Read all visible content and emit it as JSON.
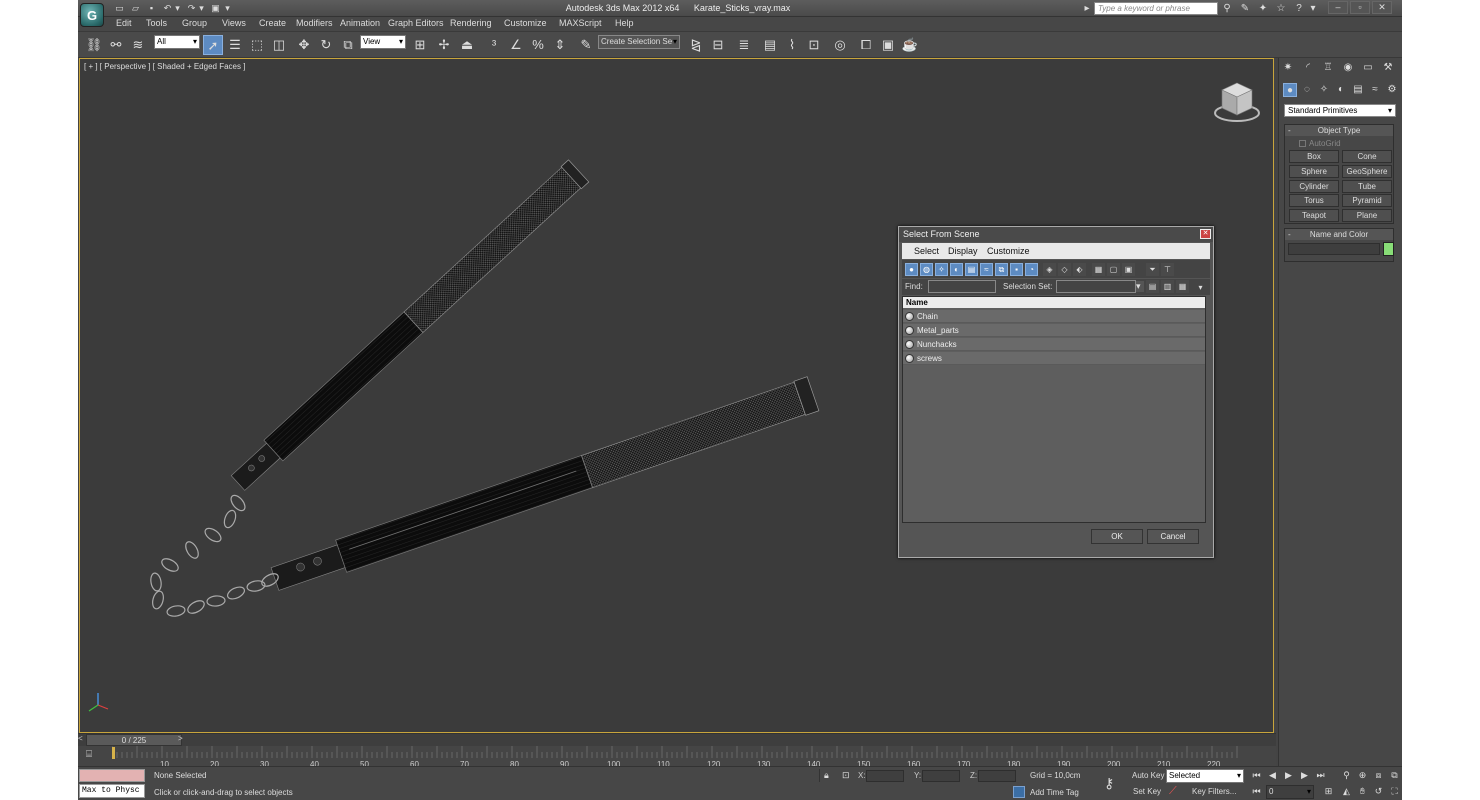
{
  "app": {
    "name": "Autodesk 3ds Max  2012 x64",
    "file": "Karate_Sticks_vray.max",
    "logo_letter": "G"
  },
  "search": {
    "placeholder": "Type a keyword or phrase"
  },
  "menu": [
    "Edit",
    "Tools",
    "Group",
    "Views",
    "Create",
    "Modifiers",
    "Animation",
    "Graph Editors",
    "Rendering",
    "Customize",
    "MAXScript",
    "Help"
  ],
  "toolbar": {
    "selection_filter": "All",
    "ref_coord": "View",
    "named_selection": "Create Selection Se"
  },
  "viewport": {
    "label": "[ + ] [ Perspective ] [ Shaded + Edged Faces ]",
    "active_color": "#c8a53c"
  },
  "command_panel": {
    "category": "Standard Primitives",
    "object_type_title": "Object Type",
    "autogrid_label": "AutoGrid",
    "buttons": [
      "Box",
      "Cone",
      "Sphere",
      "GeoSphere",
      "Cylinder",
      "Tube",
      "Torus",
      "Pyramid",
      "Teapot",
      "Plane"
    ],
    "name_color_title": "Name and Color",
    "object_color": "#88dd77"
  },
  "dialog": {
    "title": "Select From Scene",
    "menu": [
      "Select",
      "Display",
      "Customize"
    ],
    "find_label": "Find:",
    "selection_set_label": "Selection Set:",
    "column_name": "Name",
    "rows": [
      "Chain",
      "Metal_parts",
      "Nunchacks",
      "screws"
    ],
    "ok": "OK",
    "cancel": "Cancel"
  },
  "timeline": {
    "frame_label": "0 / 225",
    "ticks": [
      "10",
      "20",
      "30",
      "40",
      "50",
      "60",
      "70",
      "80",
      "90",
      "100",
      "110",
      "120",
      "130",
      "140",
      "150",
      "160",
      "170",
      "180",
      "190",
      "200",
      "210",
      "220"
    ]
  },
  "status": {
    "selection": "None Selected",
    "prompt": "Click or click-and-drag to select objects",
    "maxscript": "Max to Physc",
    "x_label": "X:",
    "y_label": "Y:",
    "z_label": "Z:",
    "grid": "Grid = 10,0cm",
    "add_time_tag": "Add Time Tag",
    "auto_key": "Auto Key",
    "set_key": "Set Key",
    "key_mode": "Selected",
    "key_filters": "Key Filters...",
    "current_frame": "0"
  }
}
